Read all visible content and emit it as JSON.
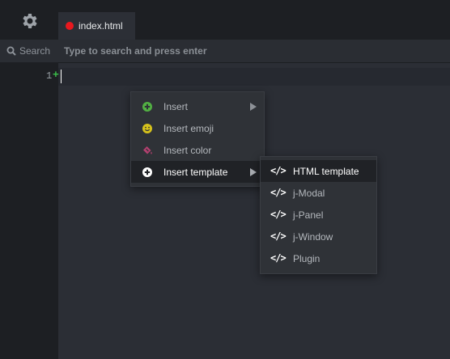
{
  "tab": {
    "filename": "index.html",
    "status_color": "#e8181e"
  },
  "sidebar": {
    "search_label": "Search"
  },
  "search": {
    "placeholder": "Type to search and press enter"
  },
  "editor": {
    "line_number": "1",
    "line_marker": "+"
  },
  "context_menu": {
    "items": [
      {
        "label": "Insert",
        "icon": "plus-circle-icon",
        "color": "#52b043"
      },
      {
        "label": "Insert emoji",
        "icon": "smiley-icon",
        "color": "#d6c21c"
      },
      {
        "label": "Insert color",
        "icon": "paint-bucket-icon",
        "color": "#b3406f"
      },
      {
        "label": "Insert template",
        "icon": "plus-circle-icon",
        "color": "#ffffff"
      }
    ]
  },
  "submenu": {
    "items": [
      {
        "label": "HTML template",
        "icon": "code-icon"
      },
      {
        "label": "j-Modal",
        "icon": "code-icon"
      },
      {
        "label": "j-Panel",
        "icon": "code-icon"
      },
      {
        "label": "j-Window",
        "icon": "code-icon"
      },
      {
        "label": "Plugin",
        "icon": "code-icon"
      }
    ]
  }
}
